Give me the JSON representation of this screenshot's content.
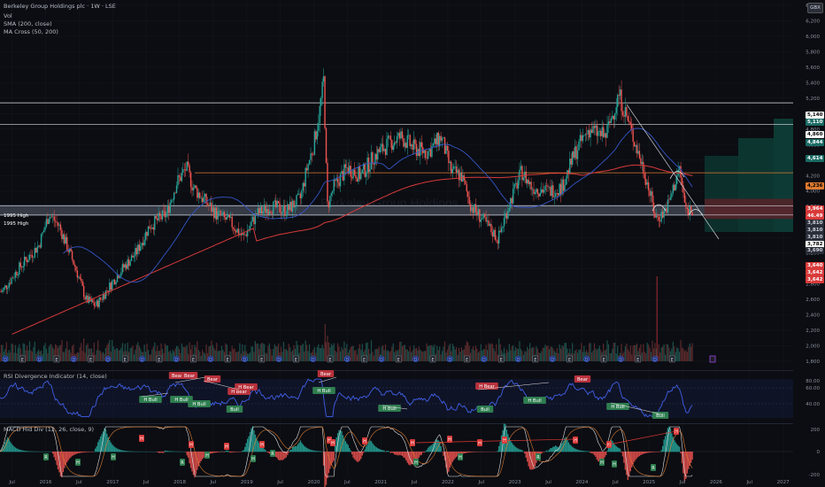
{
  "header": {
    "symbol_title": "Berkeley Group Holdings plc · 1W · LSE",
    "indicators": [
      "Vol",
      "SMA (200, close)",
      "MA Cross (50, 200)"
    ],
    "watermark": "Berkeley Group Holdings"
  },
  "currency": "GBX",
  "colors": {
    "background": "#0b0d12",
    "up": "#26a69a",
    "down": "#ef5350",
    "sma200": "#d83a3a",
    "ma50": "#3656c8",
    "rsi": "#3f5fe6",
    "resistance_orange": "#e07b2f",
    "level_white": "#e0e0e0"
  },
  "levels": [
    {
      "label": "1995 High",
      "price": 3810
    },
    {
      "label": "1995 High",
      "price": 3690
    }
  ],
  "price_axis": [
    "6,400",
    "6,200",
    "6,000",
    "5,800",
    "5,600",
    "5,400",
    "5,200",
    "5,000",
    "4,800",
    "4,600",
    "4,400",
    "4,200",
    "4,000",
    "3,800",
    "3,600",
    "3,400",
    "3,200",
    "3,000",
    "2,800",
    "2,600",
    "2,400",
    "2,200",
    "2,000",
    "1,800"
  ],
  "price_badges": [
    {
      "text": "5,140",
      "bg": "#ffffff",
      "fg": "#000000"
    },
    {
      "text": "5,110",
      "bg": "#1b6b64",
      "fg": "#ffffff"
    },
    {
      "text": "4,860",
      "bg": "#ffffff",
      "fg": "#000000"
    },
    {
      "text": "4,844",
      "bg": "#1b6b64",
      "fg": "#ffffff"
    },
    {
      "text": "4,614",
      "bg": "#1b6b64",
      "fg": "#ffffff"
    },
    {
      "text": "4,236",
      "bg": "#e07b2f",
      "fg": "#000000"
    },
    {
      "text": "3,964",
      "bg": "#d93a3a",
      "fg": "#ffffff"
    },
    {
      "text": "46.49",
      "bg": "#d93a3a",
      "fg": "#ffffff"
    },
    {
      "text": "3,810",
      "bg": "#2a2e39",
      "fg": "#d1d4dc"
    },
    {
      "text": "3,810",
      "bg": "#2a2e39",
      "fg": "#d1d4dc"
    },
    {
      "text": "3,810",
      "bg": "#2a2e39",
      "fg": "#d1d4dc"
    },
    {
      "text": "3,782",
      "bg": "#ffffff",
      "fg": "#000000"
    },
    {
      "text": "3,690",
      "bg": "#2a2e39",
      "fg": "#d1d4dc"
    },
    {
      "text": "3,640",
      "bg": "#d93a3a",
      "fg": "#ffffff"
    },
    {
      "text": "3,642",
      "bg": "#d93a3a",
      "fg": "#ffffff"
    },
    {
      "text": "3,642",
      "bg": "#d93a3a",
      "fg": "#ffffff"
    }
  ],
  "rsi_panel": {
    "title": "RSI Divergence Indicator (14, close)",
    "axis": [
      "80.00",
      "60.00",
      "40.00"
    ],
    "labels": [
      {
        "text": "Bear",
        "kind": "bear"
      },
      {
        "text": "Bear",
        "kind": "bear"
      },
      {
        "text": "Bear",
        "kind": "bear"
      },
      {
        "text": "H Bear",
        "kind": "bear"
      },
      {
        "text": "H Bear",
        "kind": "bear"
      },
      {
        "text": "Bear",
        "kind": "bear"
      },
      {
        "text": "H Bear",
        "kind": "bear"
      },
      {
        "text": "Bear",
        "kind": "bear"
      },
      {
        "text": "H Bull",
        "kind": "bull"
      },
      {
        "text": "H Bull",
        "kind": "bull"
      },
      {
        "text": "H Bull",
        "kind": "bull"
      },
      {
        "text": "Bull",
        "kind": "bull"
      },
      {
        "text": "H Bull",
        "kind": "bull"
      },
      {
        "text": "H Bull",
        "kind": "bull"
      },
      {
        "text": "Bull",
        "kind": "bull"
      },
      {
        "text": "H Bull",
        "kind": "bull"
      },
      {
        "text": "H Bull",
        "kind": "bull"
      },
      {
        "text": "Bull",
        "kind": "bull"
      }
    ]
  },
  "macd_panel": {
    "title": "MACD Hid Div (12, 26, close, 9)",
    "axis": [
      "200",
      "0",
      "-200"
    ]
  },
  "time_axis": [
    "Jul",
    "2016",
    "Jul",
    "2017",
    "Jul",
    "2018",
    "Jul",
    "2019",
    "Jul",
    "2020",
    "Jul",
    "2021",
    "Jul",
    "2022",
    "Jul",
    "2023",
    "Jul",
    "2024",
    "Jul",
    "2025",
    "Jul",
    "2026",
    "Jul",
    "2027"
  ],
  "chart_data": {
    "type": "candlestick",
    "title": "Berkeley Group Holdings plc · 1W · LSE",
    "x_range": [
      "2015-05",
      "2027-03"
    ],
    "ylim": [
      1800,
      6400
    ],
    "price_path": [
      [
        2015.35,
        2700
      ],
      [
        2015.6,
        3000
      ],
      [
        2015.9,
        3300
      ],
      [
        2016.05,
        3700
      ],
      [
        2016.2,
        3550
      ],
      [
        2016.45,
        3000
      ],
      [
        2016.6,
        2600
      ],
      [
        2016.75,
        2520
      ],
      [
        2016.9,
        2700
      ],
      [
        2017.1,
        2950
      ],
      [
        2017.35,
        3200
      ],
      [
        2017.55,
        3550
      ],
      [
        2017.8,
        3700
      ],
      [
        2017.95,
        4100
      ],
      [
        2018.1,
        4300
      ],
      [
        2018.2,
        4050
      ],
      [
        2018.4,
        3850
      ],
      [
        2018.55,
        3700
      ],
      [
        2018.75,
        3600
      ],
      [
        2018.95,
        3400
      ],
      [
        2019.15,
        3700
      ],
      [
        2019.35,
        3800
      ],
      [
        2019.6,
        3750
      ],
      [
        2019.8,
        3900
      ],
      [
        2019.9,
        4300
      ],
      [
        2020.0,
        4600
      ],
      [
        2020.1,
        5100
      ],
      [
        2020.15,
        5450
      ],
      [
        2020.2,
        3800
      ],
      [
        2020.3,
        4050
      ],
      [
        2020.5,
        4300
      ],
      [
        2020.7,
        4200
      ],
      [
        2020.9,
        4450
      ],
      [
        2021.1,
        4600
      ],
      [
        2021.3,
        4700
      ],
      [
        2021.5,
        4550
      ],
      [
        2021.7,
        4500
      ],
      [
        2021.9,
        4700
      ],
      [
        2022.05,
        4250
      ],
      [
        2022.2,
        4200
      ],
      [
        2022.35,
        3800
      ],
      [
        2022.5,
        3650
      ],
      [
        2022.75,
        3380
      ],
      [
        2022.9,
        3800
      ],
      [
        2023.1,
        4250
      ],
      [
        2023.25,
        4050
      ],
      [
        2023.5,
        4000
      ],
      [
        2023.7,
        4050
      ],
      [
        2023.9,
        4500
      ],
      [
        2024.1,
        4800
      ],
      [
        2024.35,
        4700
      ],
      [
        2024.55,
        5250
      ],
      [
        2024.65,
        5000
      ],
      [
        2024.8,
        4600
      ],
      [
        2024.95,
        4200
      ],
      [
        2025.1,
        3650
      ],
      [
        2025.2,
        3700
      ],
      [
        2025.3,
        3850
      ],
      [
        2025.45,
        4300
      ],
      [
        2025.55,
        3750
      ],
      [
        2025.65,
        3780
      ]
    ]
  }
}
